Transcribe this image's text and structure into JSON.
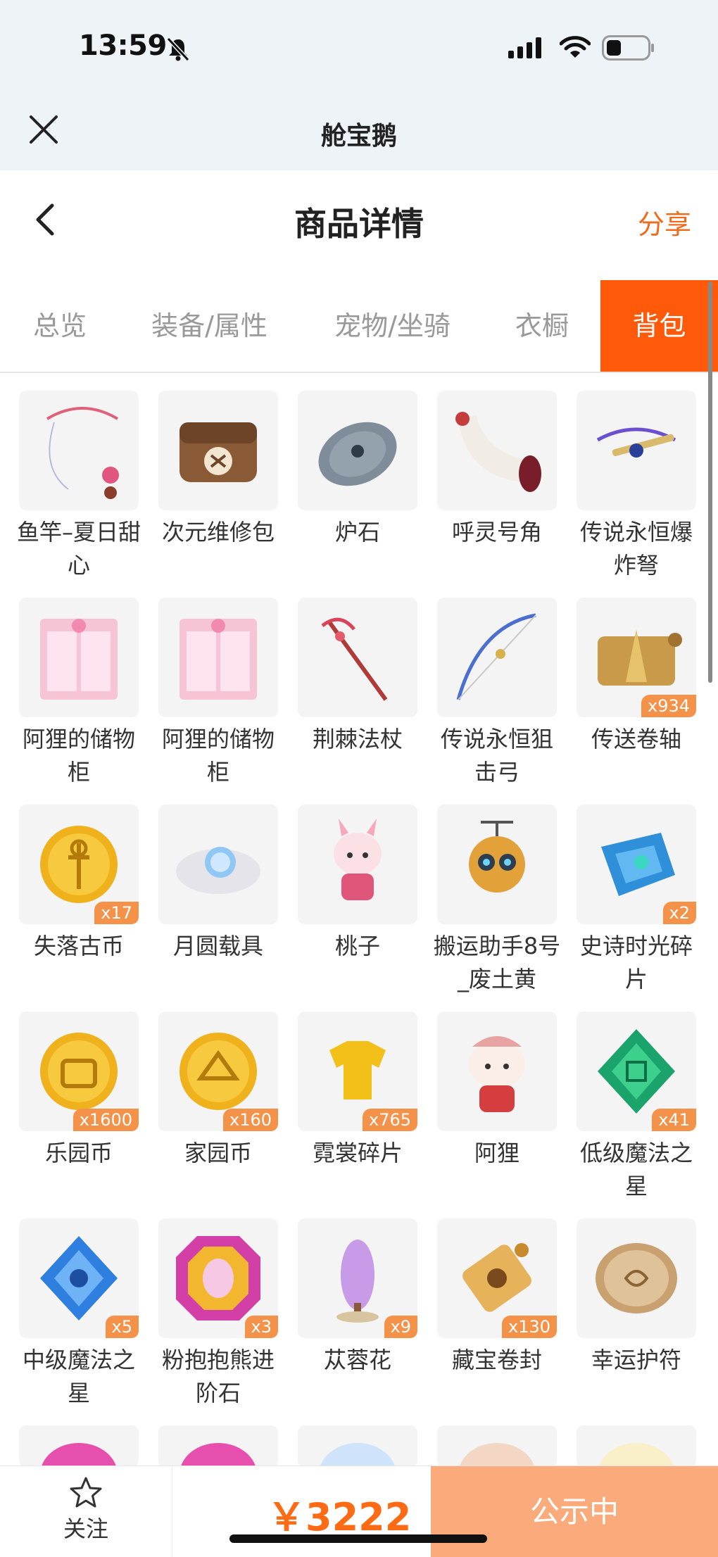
{
  "status_bar": {
    "time": "13:59"
  },
  "app": {
    "title": "舱宝鹅"
  },
  "header": {
    "title": "商品详情",
    "share": "分享"
  },
  "tabs": [
    "总览",
    "装备/属性",
    "宠物/坐骑",
    "衣橱",
    "背包"
  ],
  "active_tab": "背包",
  "items": [
    {
      "name": "鱼竿–夏日甜心",
      "qty": ""
    },
    {
      "name": "次元维修包",
      "qty": ""
    },
    {
      "name": "炉石",
      "qty": ""
    },
    {
      "name": "呼灵号角",
      "qty": ""
    },
    {
      "name": "传说永恒爆炸弩",
      "qty": ""
    },
    {
      "name": "阿狸的储物柜",
      "qty": ""
    },
    {
      "name": "阿狸的储物柜",
      "qty": ""
    },
    {
      "name": "荆棘法杖",
      "qty": ""
    },
    {
      "name": "传说永恒狙击弓",
      "qty": ""
    },
    {
      "name": "传送卷轴",
      "qty": "x934"
    },
    {
      "name": "失落古币",
      "qty": "x17"
    },
    {
      "name": "月圆载具",
      "qty": ""
    },
    {
      "name": "桃子",
      "qty": ""
    },
    {
      "name": "搬运助手8号_废土黄",
      "qty": ""
    },
    {
      "name": "史诗时光碎片",
      "qty": "x2"
    },
    {
      "name": "乐园币",
      "qty": "x1600"
    },
    {
      "name": "家园币",
      "qty": "x160"
    },
    {
      "name": "霓裳碎片",
      "qty": "x765"
    },
    {
      "name": "阿狸",
      "qty": ""
    },
    {
      "name": "低级魔法之星",
      "qty": "x41"
    },
    {
      "name": "中级魔法之星",
      "qty": "x5"
    },
    {
      "name": "粉抱抱熊进阶石",
      "qty": "x3"
    },
    {
      "name": "苁蓉花",
      "qty": "x9"
    },
    {
      "name": "藏宝卷封",
      "qty": "x130"
    },
    {
      "name": "幸运护符",
      "qty": ""
    }
  ],
  "bottom": {
    "follow": "关注",
    "price": "￥3222",
    "status": "公示中"
  },
  "colors": {
    "accent": "#ff5a0a",
    "price": "#ff6a14",
    "status_button": "#fbaa7c",
    "qty_badge": "#f5924a"
  }
}
